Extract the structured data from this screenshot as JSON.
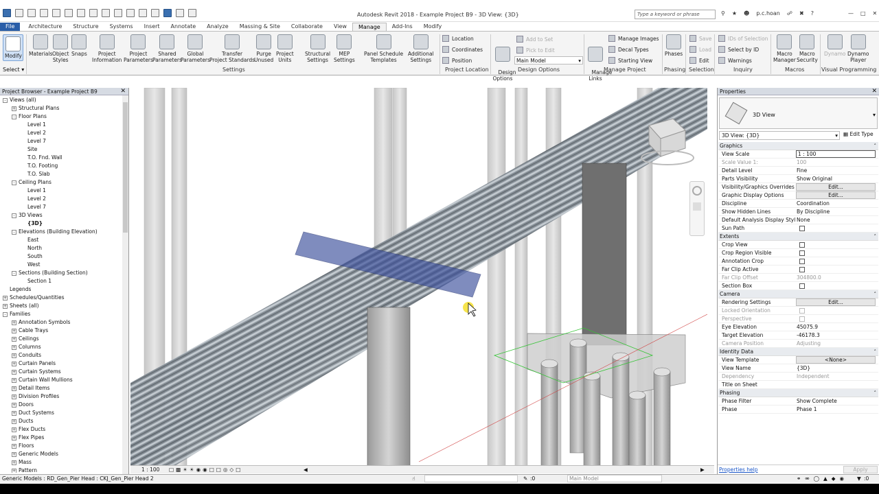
{
  "app": {
    "title": "Autodesk Revit 2018 -   Example Project B9 - 3D View: {3D}",
    "search_placeholder": "Type a keyword or phrase",
    "user": "p.c.hoan"
  },
  "ribbon_tabs": [
    "File",
    "Architecture",
    "Structure",
    "Systems",
    "Insert",
    "Annotate",
    "Analyze",
    "Massing & Site",
    "Collaborate",
    "View",
    "Manage",
    "Add-Ins",
    "Modify"
  ],
  "active_tab": "Manage",
  "ribbon": {
    "modify": "Modify",
    "select": "Select",
    "settings_buttons": [
      "Materials",
      "Object\nStyles",
      "Snaps",
      "Project\nInformation",
      "Project\nParameters",
      "Shared\nParameters",
      "Global\nParameters",
      "Transfer\nProject Standards",
      "Purge\nUnused",
      "Project\nUnits",
      "Structural\nSettings",
      "MEP\nSettings",
      "Panel Schedule\nTemplates",
      "Additional\nSettings"
    ],
    "settings_label": "Settings",
    "location_items": [
      "Location",
      "Coordinates",
      "Position"
    ],
    "project_location_label": "Project Location",
    "design_options": "Design\nOptions",
    "design_options_small": [
      "Add to Set",
      "Pick to Edit"
    ],
    "main_model": "Main Model",
    "design_options_label": "Design Options",
    "manage_links": "Manage\nLinks",
    "manage_project_items": [
      "Manage Images",
      "Decal  Types",
      "Starting  View"
    ],
    "manage_project_label": "Manage Project",
    "phases": "Phases",
    "phasing_label": "Phasing",
    "selection_items": [
      "Save",
      "Load",
      "Edit"
    ],
    "selection_label": "Selection",
    "inquiry_items": [
      "IDs of Selection",
      "Select by ID",
      "Warnings"
    ],
    "inquiry_label": "Inquiry",
    "macro_buttons": [
      "Macro\nManager",
      "Macro\nSecurity"
    ],
    "macros_label": "Macros",
    "dynamo_buttons": [
      "Dynamo",
      "Dynamo\nPlayer"
    ],
    "visual_programming_label": "Visual Programming"
  },
  "project_browser": {
    "title": "Project Browser - Example Project B9",
    "items": [
      {
        "label": "Views (all)",
        "level": 0,
        "toggle": "-"
      },
      {
        "label": "Structural Plans",
        "level": 1,
        "toggle": "+"
      },
      {
        "label": "Floor Plans",
        "level": 1,
        "toggle": "-"
      },
      {
        "label": "Level 1",
        "level": 2,
        "toggle": ""
      },
      {
        "label": "Level 2",
        "level": 2,
        "toggle": ""
      },
      {
        "label": "Level 7",
        "level": 2,
        "toggle": ""
      },
      {
        "label": "Site",
        "level": 2,
        "toggle": ""
      },
      {
        "label": "T.O. Fnd. Wall",
        "level": 2,
        "toggle": ""
      },
      {
        "label": "T.O. Footing",
        "level": 2,
        "toggle": ""
      },
      {
        "label": "T.O. Slab",
        "level": 2,
        "toggle": ""
      },
      {
        "label": "Ceiling Plans",
        "level": 1,
        "toggle": "-"
      },
      {
        "label": "Level 1",
        "level": 2,
        "toggle": ""
      },
      {
        "label": "Level 2",
        "level": 2,
        "toggle": ""
      },
      {
        "label": "Level 7",
        "level": 2,
        "toggle": ""
      },
      {
        "label": "3D Views",
        "level": 1,
        "toggle": "-"
      },
      {
        "label": "{3D}",
        "level": 2,
        "toggle": "",
        "bold": true
      },
      {
        "label": "Elevations (Building Elevation)",
        "level": 1,
        "toggle": "-"
      },
      {
        "label": "East",
        "level": 2,
        "toggle": ""
      },
      {
        "label": "North",
        "level": 2,
        "toggle": ""
      },
      {
        "label": "South",
        "level": 2,
        "toggle": ""
      },
      {
        "label": "West",
        "level": 2,
        "toggle": ""
      },
      {
        "label": "Sections (Building Section)",
        "level": 1,
        "toggle": "-"
      },
      {
        "label": "Section 1",
        "level": 2,
        "toggle": ""
      },
      {
        "label": "Legends",
        "level": 0,
        "toggle": ""
      },
      {
        "label": "Schedules/Quantities",
        "level": 0,
        "toggle": "+"
      },
      {
        "label": "Sheets (all)",
        "level": 0,
        "toggle": "+"
      },
      {
        "label": "Families",
        "level": 0,
        "toggle": "-"
      },
      {
        "label": "Annotation Symbols",
        "level": 1,
        "toggle": "+"
      },
      {
        "label": "Cable Trays",
        "level": 1,
        "toggle": "+"
      },
      {
        "label": "Ceilings",
        "level": 1,
        "toggle": "+"
      },
      {
        "label": "Columns",
        "level": 1,
        "toggle": "+"
      },
      {
        "label": "Conduits",
        "level": 1,
        "toggle": "+"
      },
      {
        "label": "Curtain Panels",
        "level": 1,
        "toggle": "+"
      },
      {
        "label": "Curtain Systems",
        "level": 1,
        "toggle": "+"
      },
      {
        "label": "Curtain Wall Mullions",
        "level": 1,
        "toggle": "+"
      },
      {
        "label": "Detail Items",
        "level": 1,
        "toggle": "+"
      },
      {
        "label": "Division Profiles",
        "level": 1,
        "toggle": "+"
      },
      {
        "label": "Doors",
        "level": 1,
        "toggle": "+"
      },
      {
        "label": "Duct Systems",
        "level": 1,
        "toggle": "+"
      },
      {
        "label": "Ducts",
        "level": 1,
        "toggle": "+"
      },
      {
        "label": "Flex Ducts",
        "level": 1,
        "toggle": "+"
      },
      {
        "label": "Flex Pipes",
        "level": 1,
        "toggle": "+"
      },
      {
        "label": "Floors",
        "level": 1,
        "toggle": "+"
      },
      {
        "label": "Generic Models",
        "level": 1,
        "toggle": "+"
      },
      {
        "label": "Mass",
        "level": 1,
        "toggle": "+"
      },
      {
        "label": "Pattern",
        "level": 1,
        "toggle": "+"
      }
    ]
  },
  "view_bar": {
    "scale": "1 : 100"
  },
  "properties": {
    "title": "Properties",
    "type_name": "3D View",
    "instance_selector": "3D View: {3D}",
    "edit_type": "Edit Type",
    "groups": [
      {
        "name": "Graphics",
        "rows": [
          {
            "k": "View Scale",
            "v": "1 : 100",
            "kind": "input"
          },
          {
            "k": "Scale Value    1:",
            "v": "100",
            "kind": "dim"
          },
          {
            "k": "Detail Level",
            "v": "Fine",
            "kind": "text"
          },
          {
            "k": "Parts Visibility",
            "v": "Show Original",
            "kind": "text"
          },
          {
            "k": "Visibility/Graphics Overrides",
            "v": "Edit...",
            "kind": "button"
          },
          {
            "k": "Graphic Display Options",
            "v": "Edit...",
            "kind": "button"
          },
          {
            "k": "Discipline",
            "v": "Coordination",
            "kind": "text"
          },
          {
            "k": "Show Hidden Lines",
            "v": "By Discipline",
            "kind": "text"
          },
          {
            "k": "Default Analysis Display Style",
            "v": "None",
            "kind": "text"
          },
          {
            "k": "Sun Path",
            "v": "",
            "kind": "check"
          }
        ]
      },
      {
        "name": "Extents",
        "rows": [
          {
            "k": "Crop View",
            "v": "",
            "kind": "check"
          },
          {
            "k": "Crop Region Visible",
            "v": "",
            "kind": "check"
          },
          {
            "k": "Annotation Crop",
            "v": "",
            "kind": "check"
          },
          {
            "k": "Far Clip Active",
            "v": "",
            "kind": "check"
          },
          {
            "k": "Far Clip Offset",
            "v": "304800.0",
            "kind": "dim"
          },
          {
            "k": "Section Box",
            "v": "",
            "kind": "check"
          }
        ]
      },
      {
        "name": "Camera",
        "rows": [
          {
            "k": "Rendering Settings",
            "v": "Edit...",
            "kind": "button"
          },
          {
            "k": "Locked Orientation",
            "v": "",
            "kind": "checkdim"
          },
          {
            "k": "Perspective",
            "v": "",
            "kind": "checkdim"
          },
          {
            "k": "Eye Elevation",
            "v": "45075.9",
            "kind": "text"
          },
          {
            "k": "Target Elevation",
            "v": "-46178.3",
            "kind": "text"
          },
          {
            "k": "Camera Position",
            "v": "Adjusting",
            "kind": "dim"
          }
        ]
      },
      {
        "name": "Identity Data",
        "rows": [
          {
            "k": "View Template",
            "v": "<None>",
            "kind": "button"
          },
          {
            "k": "View Name",
            "v": "{3D}",
            "kind": "text"
          },
          {
            "k": "Dependency",
            "v": "Independent",
            "kind": "dim"
          },
          {
            "k": "Title on Sheet",
            "v": "",
            "kind": "text"
          }
        ]
      },
      {
        "name": "Phasing",
        "rows": [
          {
            "k": "Phase Filter",
            "v": "Show Complete",
            "kind": "text"
          },
          {
            "k": "Phase",
            "v": "Phase 1",
            "kind": "text"
          }
        ]
      }
    ],
    "help_link": "Properties help",
    "apply": "Apply"
  },
  "status_bar": {
    "text": "Generic Models : RD_Gen_Pier Head : CKJ_Gen_Pier Head 2",
    "zero": ":0",
    "model": "Main Model"
  }
}
